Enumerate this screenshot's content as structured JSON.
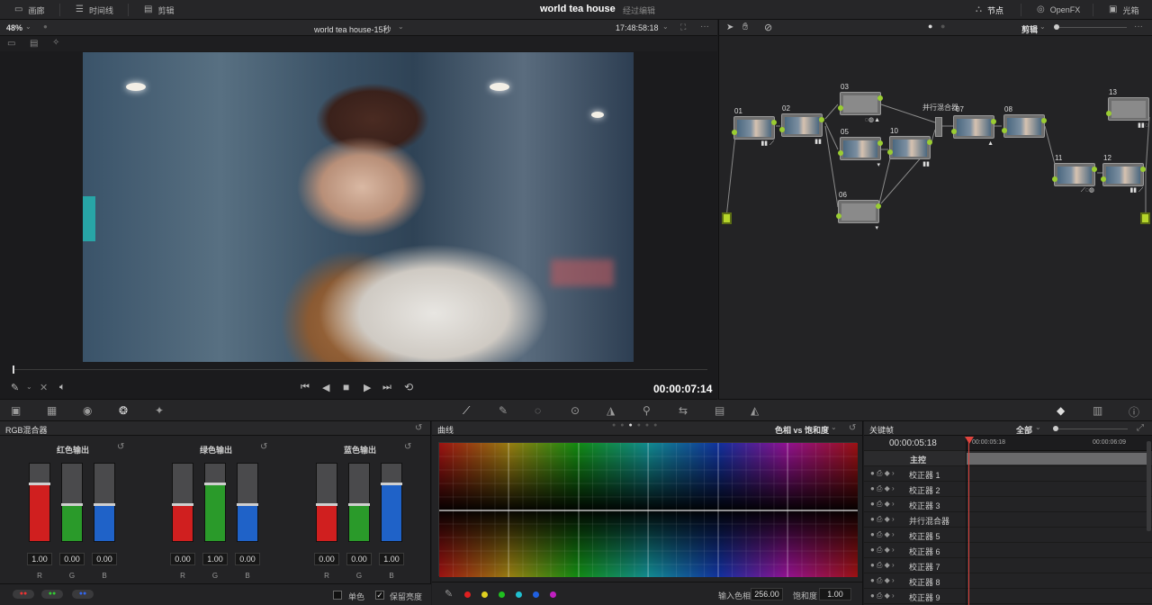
{
  "topbar": {
    "tabs": [
      {
        "label": "画廊",
        "icon": "gallery-icon"
      },
      {
        "label": "时间线",
        "icon": "timeline-icon"
      },
      {
        "label": "剪辑",
        "icon": "clips-icon"
      }
    ],
    "project_title": "world tea house",
    "project_status": "经过编辑",
    "right": [
      {
        "label": "节点",
        "icon": "nodes-icon"
      },
      {
        "label": "OpenFX",
        "icon": "openfx-icon"
      },
      {
        "label": "光箱",
        "icon": "lightbox-icon"
      }
    ]
  },
  "viewer": {
    "zoom": "48%",
    "clip_name": "world tea house-15秒",
    "source_timecode": "17:48:58:18",
    "playback_timecode": "00:00:07:14"
  },
  "nodes": {
    "mode": "剪辑",
    "parallel_mixer_label": "并行混合器",
    "items": [
      "01",
      "02",
      "03",
      "05",
      "06",
      "07",
      "08",
      "10",
      "11",
      "12",
      "13"
    ]
  },
  "rgb_mixer": {
    "title": "RGB混合器",
    "groups": [
      {
        "title": "红色输出",
        "values": [
          "1.00",
          "0.00",
          "0.00"
        ],
        "levels": [
          0.75,
          0.48,
          0.48
        ]
      },
      {
        "title": "绿色输出",
        "values": [
          "0.00",
          "1.00",
          "0.00"
        ],
        "levels": [
          0.48,
          0.75,
          0.48
        ]
      },
      {
        "title": "蓝色输出",
        "values": [
          "0.00",
          "0.00",
          "1.00"
        ],
        "levels": [
          0.48,
          0.48,
          0.75
        ]
      }
    ],
    "channel_labels": [
      "R",
      "G",
      "B"
    ],
    "mono_label": "单色",
    "preserve_label": "保留亮度"
  },
  "curves": {
    "title": "曲线",
    "mode": "色相 vs 饱和度",
    "input_hue_label": "输入色相",
    "input_hue_value": "256.00",
    "saturation_label": "饱和度",
    "saturation_value": "1.00",
    "swatch_colors": [
      "#e02020",
      "#e0d020",
      "#20c020",
      "#20c0d0",
      "#2060e0",
      "#c020c0"
    ]
  },
  "keyframes": {
    "title": "关键帧",
    "filter": "全部",
    "timecode": "00:00:05:18",
    "ruler": [
      "00:00:05:18",
      "00:00:06:09"
    ],
    "master_label": "主控",
    "rows": [
      "校正器 1",
      "校正器 2",
      "校正器 3",
      "并行混合器",
      "校正器 5",
      "校正器 6",
      "校正器 7",
      "校正器 8",
      "校正器 9"
    ]
  }
}
